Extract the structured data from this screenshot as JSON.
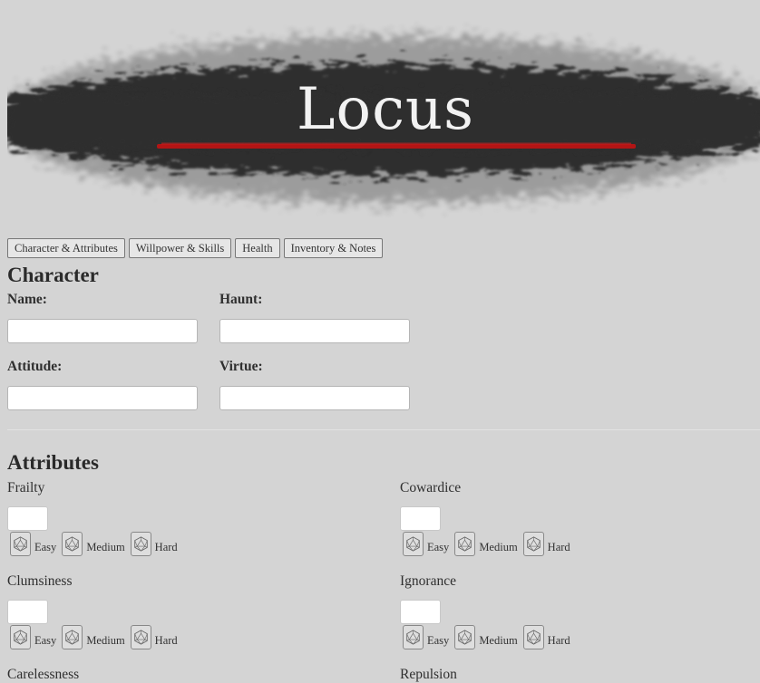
{
  "banner": {
    "title": "Locus"
  },
  "tabs": [
    "Character & Attributes",
    "Willpower & Skills",
    "Health",
    "Inventory & Notes"
  ],
  "character": {
    "heading": "Character",
    "fields": {
      "name": {
        "label": "Name:",
        "value": ""
      },
      "haunt": {
        "label": "Haunt:",
        "value": ""
      },
      "attitude": {
        "label": "Attitude:",
        "value": ""
      },
      "virtue": {
        "label": "Virtue:",
        "value": ""
      }
    }
  },
  "attributes": {
    "heading": "Attributes",
    "items": [
      {
        "label": "Frailty",
        "value": ""
      },
      {
        "label": "Cowardice",
        "value": ""
      },
      {
        "label": "Clumsiness",
        "value": ""
      },
      {
        "label": "Ignorance",
        "value": ""
      },
      {
        "label": "Carelessness",
        "value": ""
      },
      {
        "label": "Repulsion",
        "value": ""
      }
    ],
    "roll_labels": [
      "Easy",
      "Medium",
      "Hard"
    ]
  },
  "icons": {
    "die": "d20-icon",
    "accent_red": "#b31515",
    "banner_dark": "#2d2d2d"
  }
}
